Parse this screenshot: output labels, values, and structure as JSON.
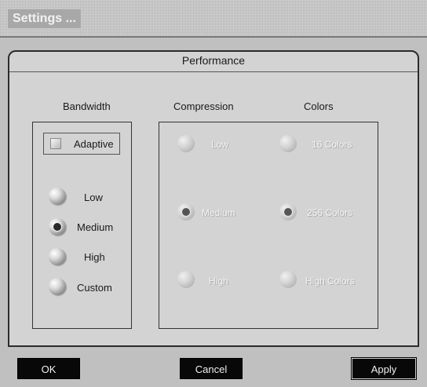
{
  "window": {
    "title": "Settings ..."
  },
  "panel": {
    "title": "Performance"
  },
  "bandwidth": {
    "header": "Bandwidth",
    "adaptive": {
      "label": "Adaptive",
      "checked": false
    },
    "options": [
      {
        "label": "Low",
        "selected": false
      },
      {
        "label": "Medium",
        "selected": true
      },
      {
        "label": "High",
        "selected": false
      },
      {
        "label": "Custom",
        "selected": false
      }
    ]
  },
  "compression": {
    "header": "Compression",
    "enabled": false,
    "options": [
      {
        "label": "Low",
        "selected": false
      },
      {
        "label": "Medium",
        "selected": true
      },
      {
        "label": "High",
        "selected": false
      }
    ]
  },
  "colors": {
    "header": "Colors",
    "enabled": false,
    "options": [
      {
        "label": "16 Colors",
        "selected": false
      },
      {
        "label": "256 Colors",
        "selected": true
      },
      {
        "label": "High Colors",
        "selected": false
      }
    ]
  },
  "buttons": {
    "ok": "OK",
    "cancel": "Cancel",
    "apply": "Apply"
  }
}
